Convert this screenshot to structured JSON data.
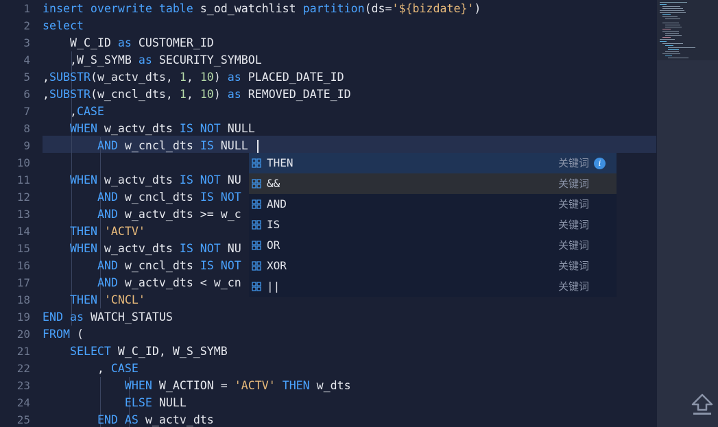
{
  "editor": {
    "line_numbers": [
      "1",
      "2",
      "3",
      "4",
      "5",
      "6",
      "7",
      "8",
      "9",
      "10",
      "11",
      "12",
      "13",
      "14",
      "15",
      "16",
      "17",
      "18",
      "19",
      "20",
      "21",
      "22",
      "23",
      "24",
      "25"
    ],
    "lines": [
      [
        [
          "kw",
          "insert overwrite table "
        ],
        [
          "tx",
          "s_od_watchlist "
        ],
        [
          "kw",
          "partition"
        ],
        [
          "pn",
          "(ds="
        ],
        [
          "str",
          "'${bizdate}'"
        ],
        [
          "pn",
          ")"
        ]
      ],
      [
        [
          "kw",
          "select"
        ]
      ],
      [
        [
          "tx",
          "    W_C_ID "
        ],
        [
          "kw",
          "as"
        ],
        [
          "tx",
          " CUSTOMER_ID"
        ]
      ],
      [
        [
          "tx",
          "    ,W_S_SYMB "
        ],
        [
          "kw",
          "as"
        ],
        [
          "tx",
          " SECURITY_SYMBOL"
        ]
      ],
      [
        [
          "tx",
          ","
        ],
        [
          "kw",
          "SUBSTR"
        ],
        [
          "tx",
          "(w_actv_dts, "
        ],
        [
          "num",
          "1"
        ],
        [
          "tx",
          ", "
        ],
        [
          "num",
          "10"
        ],
        [
          "tx",
          ") "
        ],
        [
          "kw",
          "as"
        ],
        [
          "tx",
          " PLACED_DATE_ID"
        ]
      ],
      [
        [
          "tx",
          ","
        ],
        [
          "kw",
          "SUBSTR"
        ],
        [
          "tx",
          "(w_cncl_dts, "
        ],
        [
          "num",
          "1"
        ],
        [
          "tx",
          ", "
        ],
        [
          "num",
          "10"
        ],
        [
          "tx",
          ") "
        ],
        [
          "kw",
          "as"
        ],
        [
          "tx",
          " REMOVED_DATE_ID"
        ]
      ],
      [
        [
          "tx",
          "    ,"
        ],
        [
          "kw",
          "CASE"
        ]
      ],
      [
        [
          "tx",
          "    "
        ],
        [
          "kw",
          "WHEN"
        ],
        [
          "tx",
          " w_actv_dts "
        ],
        [
          "kw",
          "IS NOT"
        ],
        [
          "tx",
          " NULL"
        ]
      ],
      [
        [
          "tx",
          "        "
        ],
        [
          "kw",
          "AND"
        ],
        [
          "tx",
          " w_cncl_dts "
        ],
        [
          "kw",
          "IS"
        ],
        [
          "tx",
          " NULL "
        ]
      ],
      [],
      [
        [
          "tx",
          "    "
        ],
        [
          "kw",
          "WHEN"
        ],
        [
          "tx",
          " w_actv_dts "
        ],
        [
          "kw",
          "IS NOT"
        ],
        [
          "tx",
          " NU"
        ]
      ],
      [
        [
          "tx",
          "        "
        ],
        [
          "kw",
          "AND"
        ],
        [
          "tx",
          " w_cncl_dts "
        ],
        [
          "kw",
          "IS NOT"
        ]
      ],
      [
        [
          "tx",
          "        "
        ],
        [
          "kw",
          "AND"
        ],
        [
          "tx",
          " w_actv_dts >= w_c"
        ]
      ],
      [
        [
          "tx",
          "    "
        ],
        [
          "kw",
          "THEN"
        ],
        [
          "tx",
          " "
        ],
        [
          "str",
          "'ACTV'"
        ]
      ],
      [
        [
          "tx",
          "    "
        ],
        [
          "kw",
          "WHEN"
        ],
        [
          "tx",
          " w_actv_dts "
        ],
        [
          "kw",
          "IS NOT"
        ],
        [
          "tx",
          " NU"
        ]
      ],
      [
        [
          "tx",
          "        "
        ],
        [
          "kw",
          "AND"
        ],
        [
          "tx",
          " w_cncl_dts "
        ],
        [
          "kw",
          "IS NOT"
        ]
      ],
      [
        [
          "tx",
          "        "
        ],
        [
          "kw",
          "AND"
        ],
        [
          "tx",
          " w_actv_dts < w_cn"
        ]
      ],
      [
        [
          "tx",
          "    "
        ],
        [
          "kw",
          "THEN"
        ],
        [
          "tx",
          " "
        ],
        [
          "str",
          "'CNCL'"
        ]
      ],
      [
        [
          "kw",
          "END"
        ],
        [
          "tx",
          " "
        ],
        [
          "kw",
          "as"
        ],
        [
          "tx",
          " WATCH_STATUS"
        ]
      ],
      [
        [
          "kw",
          "FROM"
        ],
        [
          "tx",
          " ("
        ]
      ],
      [
        [
          "tx",
          "    "
        ],
        [
          "kw",
          "SELECT"
        ],
        [
          "tx",
          " W_C_ID, W_S_SYMB"
        ]
      ],
      [
        [
          "tx",
          "        , "
        ],
        [
          "kw",
          "CASE"
        ]
      ],
      [
        [
          "tx",
          "            "
        ],
        [
          "kw",
          "WHEN"
        ],
        [
          "tx",
          " W_ACTION = "
        ],
        [
          "str",
          "'ACTV'"
        ],
        [
          "tx",
          " "
        ],
        [
          "kw",
          "THEN"
        ],
        [
          "tx",
          " w_dts"
        ]
      ],
      [
        [
          "tx",
          "            "
        ],
        [
          "kw",
          "ELSE"
        ],
        [
          "tx",
          " NULL"
        ]
      ],
      [
        [
          "tx",
          "        "
        ],
        [
          "kw",
          "END AS"
        ],
        [
          "tx",
          " w_actv_dts"
        ]
      ]
    ],
    "active_line": 9
  },
  "suggest": {
    "items": [
      {
        "label": "THEN",
        "detail": "关键词",
        "selected": true,
        "info": true
      },
      {
        "label": "&&",
        "detail": "关键词",
        "hover": true
      },
      {
        "label": "AND",
        "detail": "关键词"
      },
      {
        "label": "IS",
        "detail": "关键词"
      },
      {
        "label": "OR",
        "detail": "关键词"
      },
      {
        "label": "XOR",
        "detail": "关键词"
      },
      {
        "label": "||",
        "detail": "关键词"
      }
    ],
    "icon": "keyword-icon",
    "info_glyph": "i"
  },
  "colors": {
    "background": "#1a2034",
    "keyword": "#4aa3ff",
    "text": "#e6e8ee",
    "string": "#e7b97a",
    "number": "#b5d9a8",
    "line_number": "#6e7890",
    "active_line": "#25304e",
    "suggest_bg": "#151d33",
    "suggest_selected": "#1f3456",
    "suggest_icon": "#3e8fe0"
  }
}
